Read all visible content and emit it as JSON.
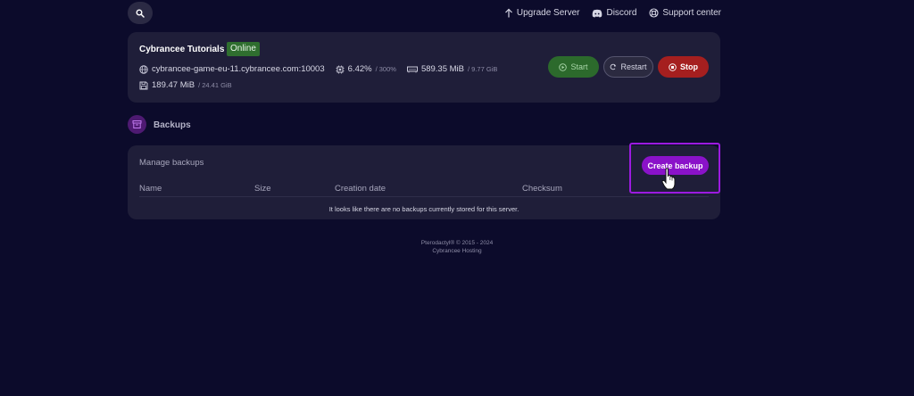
{
  "topnav": {
    "search_icon": "search-icon",
    "items": [
      {
        "label": "Upgrade Server",
        "icon": "arrow-up-icon"
      },
      {
        "label": "Discord",
        "icon": "discord-icon"
      },
      {
        "label": "Support center",
        "icon": "lifebuoy-icon"
      }
    ]
  },
  "server": {
    "name": "Cybrancee Tutorials",
    "status": "Online",
    "address": "cybrancee-game-eu-11.cybrancee.com:10003",
    "cpu": {
      "value": "6.42%",
      "limit": "/ 300%"
    },
    "memory": {
      "value": "589.35 MiB",
      "limit": "/ 9.77 GiB"
    },
    "disk": {
      "value": "189.47 MiB",
      "limit": "/ 24.41 GiB"
    },
    "buttons": {
      "start": "Start",
      "restart": "Restart",
      "stop": "Stop"
    }
  },
  "backups": {
    "section_title": "Backups",
    "manage_label": "Manage backups",
    "create_label": "Create backup",
    "columns": [
      "Name",
      "Size",
      "Creation date",
      "Checksum"
    ],
    "empty_message": "It looks like there are no backups currently stored for this server."
  },
  "footer": {
    "line1": "Pterodactyl® © 2015 - 2024",
    "line2": "Cybrancee Hosting"
  },
  "colors": {
    "background": "#0c0b2b",
    "card": "#1f1e39",
    "accent": "#8a12c9",
    "online": "#2f6e2f",
    "stop": "#a51f1f"
  }
}
